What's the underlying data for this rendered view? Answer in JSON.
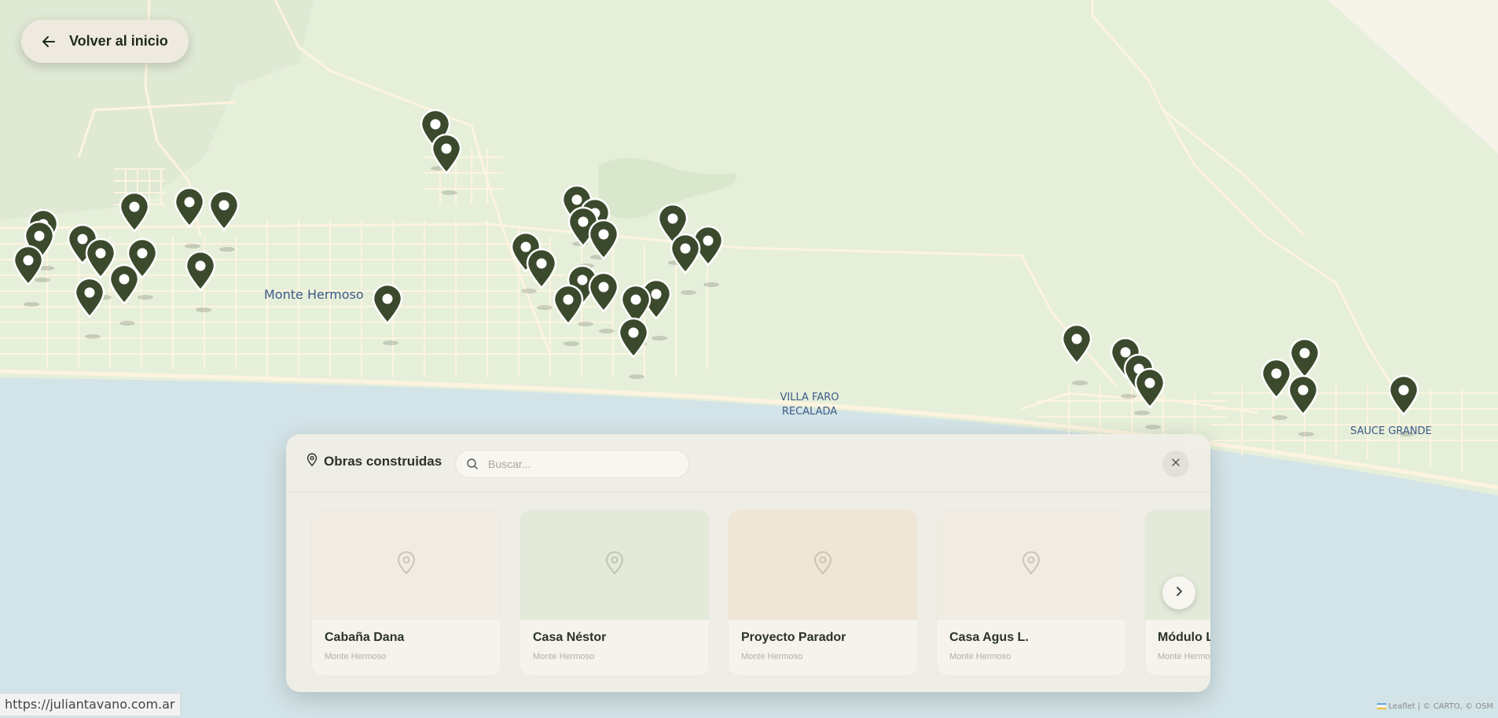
{
  "back_button": {
    "label": "Volver al inicio"
  },
  "map": {
    "labels": {
      "monte_hermoso": "Monte Hermoso",
      "villa_faro_line1": "VILLA FARO",
      "villa_faro_line2": "RECALADA",
      "sauce_grande": "SAUCE GRANDE"
    },
    "attribution": {
      "leaflet": "Leaflet",
      "separator": " | © ",
      "carto": "CARTO",
      "osm_prefix": ", © ",
      "osm": "OSM"
    },
    "colors": {
      "land": "#e6efda",
      "water": "#d3e4e8",
      "road": "#fdf4df",
      "marker": "#3b4a2c"
    }
  },
  "panel": {
    "title": "Obras construidas",
    "search_placeholder": "Buscar...",
    "cards": [
      {
        "name": "Cabaña Dana",
        "location": "Monte Hermoso",
        "bg": "#f1ece3"
      },
      {
        "name": "Casa Néstor",
        "location": "Monte Hermoso",
        "bg": "#e4eada"
      },
      {
        "name": "Proyecto Parador",
        "location": "Monte Hermoso",
        "bg": "#efe6d6"
      },
      {
        "name": "Casa Agus L.",
        "location": "Monte Hermoso",
        "bg": "#f1ece3"
      },
      {
        "name": "Módulo L",
        "location": "Monte Hermoso",
        "bg": "#e4eada"
      }
    ]
  },
  "status_bar": {
    "url": "https://juliantavano.com.ar"
  }
}
